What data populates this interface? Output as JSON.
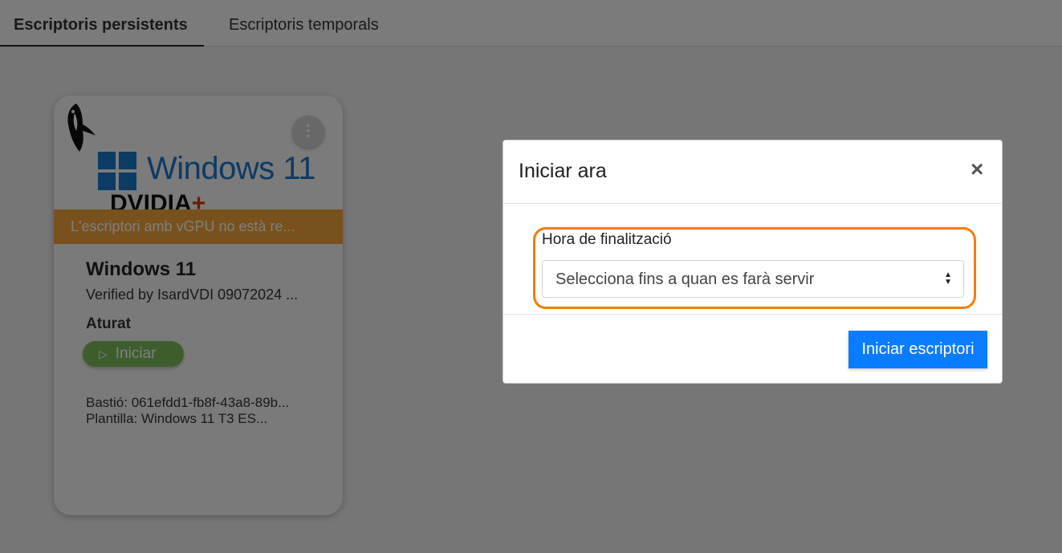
{
  "tabs": {
    "persistent": "Escriptoris persistents",
    "temporary": "Escriptoris temporals"
  },
  "card": {
    "image_alt": "Windows 11 NVIDIA",
    "windows_text": "Windows 11",
    "nvidia_text": "DVIDIA",
    "nvidia_plus": "+",
    "warning": "L'escriptori amb vGPU no està re...",
    "name": "Windows 11",
    "description": "Verified by IsardVDI 09072024 ...",
    "status": "Aturat",
    "start_label": "Iniciar",
    "start_icon": "▷",
    "bastion": "Bastió: 061efdd1-fb8f-43a8-89b...",
    "template": "Plantilla: Windows 11 T3 ES...",
    "menu_icon": "⋮"
  },
  "modal": {
    "title": "Iniciar ara",
    "close_icon": "×",
    "field_label": "Hora de finalització",
    "select_placeholder": "Selecciona fins a quan es farà servir",
    "submit_label": "Iniciar escriptori"
  },
  "colors": {
    "accent": "#0a7cff",
    "warning": "#f2a23a",
    "start_button": "#7dbb5a",
    "highlight": "#f57c00"
  }
}
